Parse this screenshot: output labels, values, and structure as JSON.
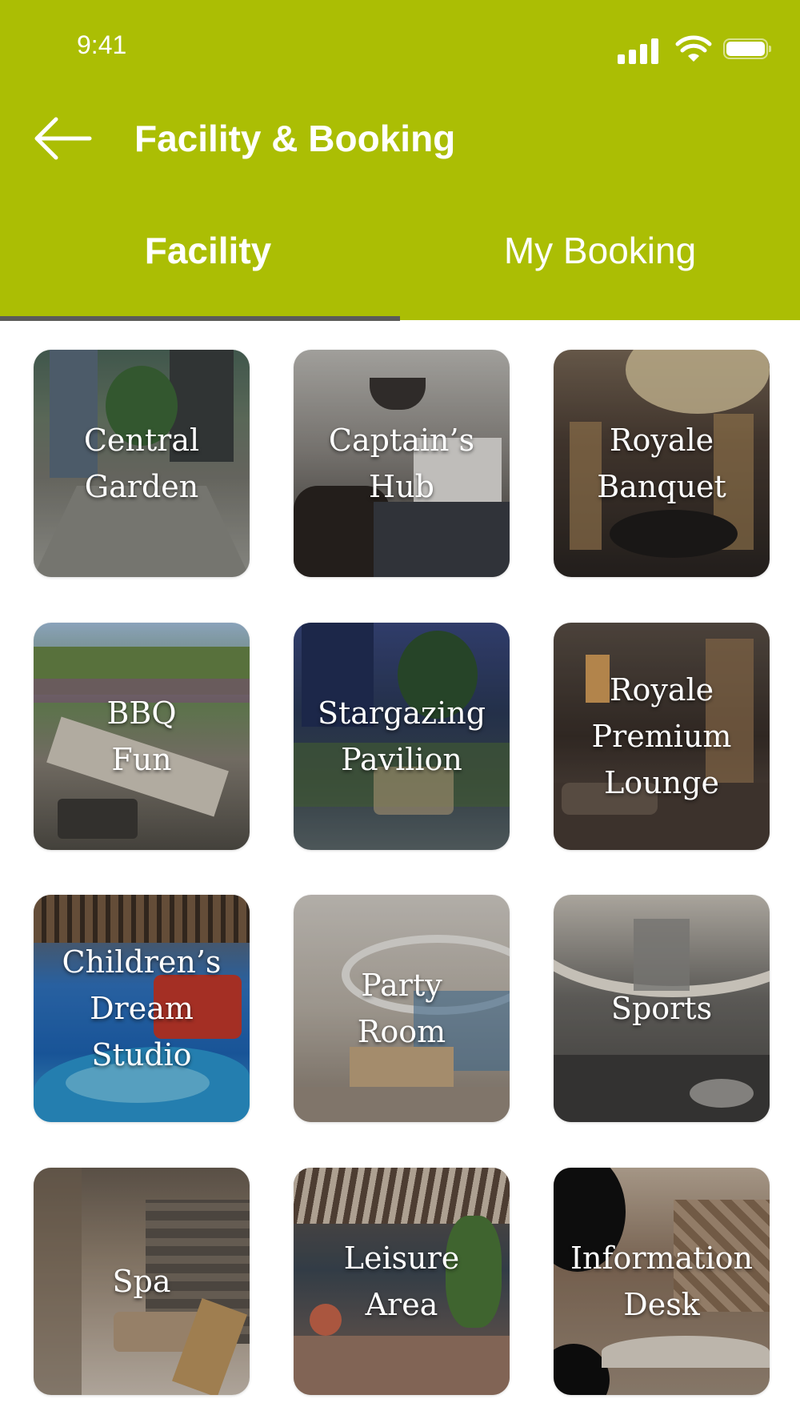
{
  "status_bar": {
    "time": "9:41"
  },
  "header": {
    "title": "Facility & Booking"
  },
  "tabs": [
    {
      "label": "Facility",
      "active": true
    },
    {
      "label": "My Booking",
      "active": false
    }
  ],
  "colors": {
    "header": "#abbe04",
    "tab_indicator": "#5b5b59",
    "text_on_header": "#ffffff"
  },
  "facilities": [
    {
      "label": "Central Garden",
      "lines": [
        "Central",
        "Garden"
      ]
    },
    {
      "label": "Captain’s Hub",
      "lines": [
        "Captain’s",
        "Hub"
      ]
    },
    {
      "label": "Royale Banquet",
      "lines": [
        "Royale",
        "Banquet"
      ]
    },
    {
      "label": "BBQ Fun",
      "lines": [
        "BBQ",
        "Fun"
      ]
    },
    {
      "label": "Stargazing Pavilion",
      "lines": [
        "Stargazing",
        "Pavilion"
      ]
    },
    {
      "label": "Royale Premium Lounge",
      "lines": [
        "Royale",
        "Premium",
        "Lounge"
      ]
    },
    {
      "label": "Children’s Dream Studio",
      "lines": [
        "Children’s",
        "Dream",
        "Studio"
      ]
    },
    {
      "label": "Party Room",
      "lines": [
        "Party",
        "Room"
      ]
    },
    {
      "label": "Sports",
      "lines": [
        "Sports"
      ]
    },
    {
      "label": "Spa",
      "lines": [
        "Spa"
      ]
    },
    {
      "label": "Leisure Area",
      "lines": [
        "Leisure",
        "Area"
      ]
    },
    {
      "label": "Information Desk",
      "lines": [
        "Information",
        "Desk"
      ]
    }
  ]
}
